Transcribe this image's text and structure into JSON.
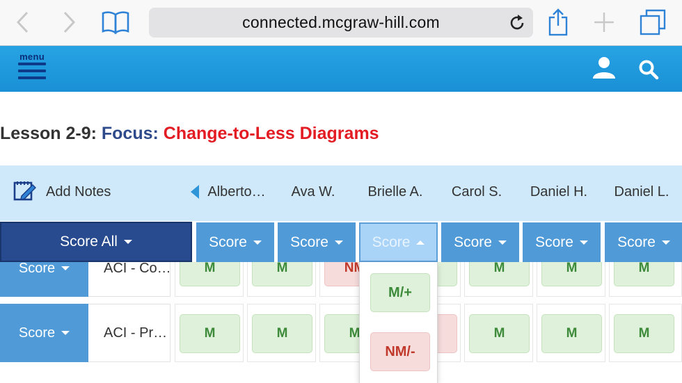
{
  "browser": {
    "url": "connected.mcgraw-hill.com",
    "icons": [
      "back-chevron-icon",
      "forward-chevron-icon",
      "bookmarks-book-icon",
      "reload-icon",
      "share-icon",
      "new-tab-plus-icon",
      "tabs-icon"
    ]
  },
  "header": {
    "menu_label": "menu",
    "icons": [
      "hamburger-menu-icon",
      "user-icon",
      "search-icon"
    ]
  },
  "lesson": {
    "prefix": "Lesson 2-9: ",
    "focus": "Focus: ",
    "topic": "Change-to-Less Diagrams"
  },
  "notes": {
    "label": "Add Notes",
    "icon": "edit-notes-icon"
  },
  "students": [
    "Alberto…",
    "Ava W.",
    "Brielle A.",
    "Carol S.",
    "Daniel H.",
    "Daniel L."
  ],
  "score_bar": {
    "all_label": "Score All",
    "column_label": "Score",
    "active_column": 2
  },
  "rows": [
    {
      "score_label": "Score",
      "label": "ACI - Co…",
      "marks": [
        "M",
        "M",
        "NM",
        "",
        "M",
        "M",
        "M"
      ]
    },
    {
      "score_label": "Score",
      "label": "ACI - Pr…",
      "marks": [
        "M",
        "M",
        "M",
        "",
        "M",
        "M",
        "M"
      ]
    }
  ],
  "dropdown": {
    "options": [
      "M/+",
      "NM/-"
    ]
  },
  "colors": {
    "header_blue": "#1a90d6",
    "score_all": "#274b8e",
    "score_button": "#4f9ad7",
    "score_active": "#a9d3f7",
    "mastered_bg": "#dff1da",
    "mastered_text": "#3c8a3a",
    "not_mastered_bg": "#f7dcdc",
    "not_mastered_text": "#c0392b",
    "focus_text": "#2d4a8a",
    "topic_text": "#e31b23"
  }
}
